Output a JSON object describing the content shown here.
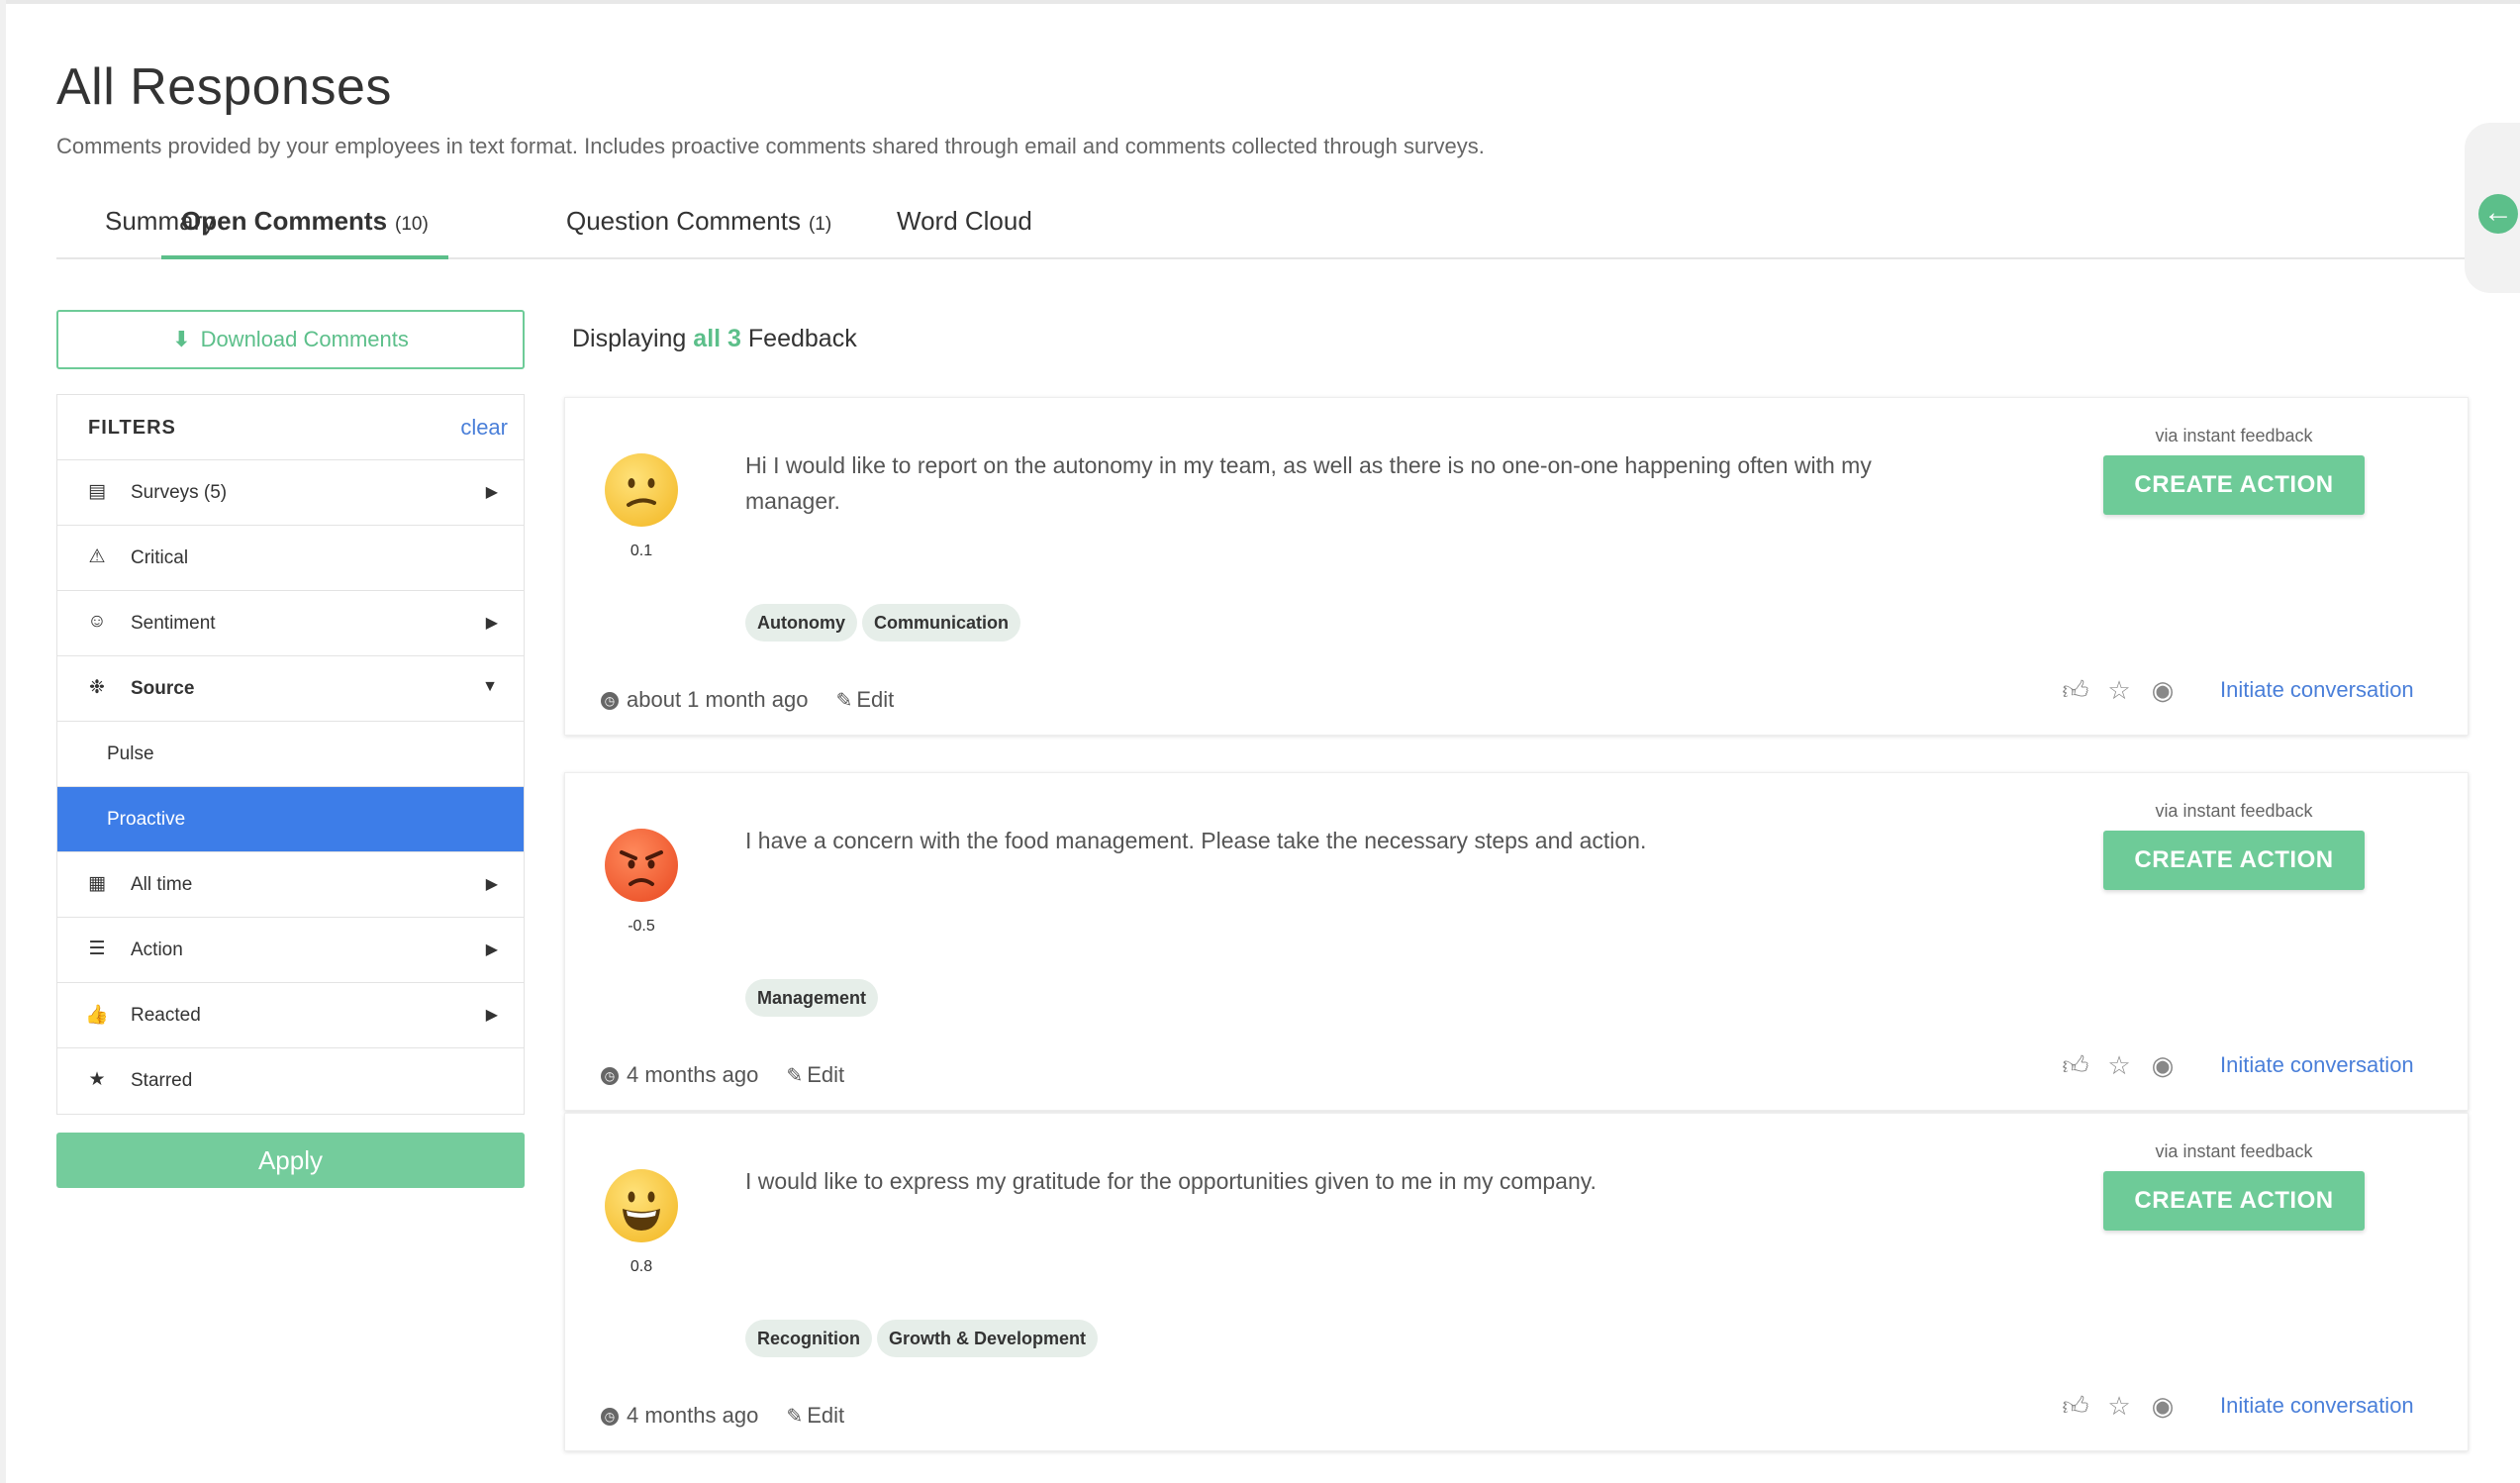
{
  "header": {
    "title": "All Responses",
    "subtitle": "Comments provided by your employees in text format. Includes proactive comments shared through email and comments collected through surveys."
  },
  "tabs": [
    {
      "label": "Summary",
      "count": ""
    },
    {
      "label": "Open Comments",
      "count": "(10)"
    },
    {
      "label": "Question Comments",
      "count": "(1)"
    },
    {
      "label": "Word Cloud",
      "count": ""
    }
  ],
  "sidebar": {
    "download_label": "Download Comments",
    "filters_title": "FILTERS",
    "clear_label": "clear",
    "rows": [
      {
        "label": "Surveys (5)",
        "icon": "survey-icon"
      },
      {
        "label": "Critical",
        "icon": "warning-icon"
      },
      {
        "label": "Sentiment",
        "icon": "smile-icon"
      },
      {
        "label": "Source",
        "icon": "gear-icon"
      },
      {
        "label": "Pulse"
      },
      {
        "label": "Proactive"
      },
      {
        "label": "All time",
        "icon": "calendar-icon"
      },
      {
        "label": "Action",
        "icon": "list-icon"
      },
      {
        "label": "Reacted",
        "icon": "thumbs-up-icon"
      },
      {
        "label": "Starred",
        "icon": "star-icon"
      }
    ],
    "apply_label": "Apply"
  },
  "main": {
    "displaying_prefix": "Displaying",
    "displaying_count": "all 3",
    "displaying_suffix": "Feedback",
    "cards": [
      {
        "score": "0.1",
        "sentiment": "neutral",
        "text": "Hi I would like to report on the autonomy in my team, as well as there is no one-on-one happening often with my manager.",
        "tags": [
          "Autonomy",
          "Communication"
        ],
        "time": "about 1 month ago",
        "edit_label": "Edit",
        "via": "via instant feedback",
        "create_label": "CREATE ACTION",
        "initiate_label": "Initiate conversation"
      },
      {
        "score": "-0.5",
        "sentiment": "angry",
        "text": "I have a concern with the food management. Please take the necessary steps and action.",
        "tags": [
          "Management"
        ],
        "time": "4 months ago",
        "edit_label": "Edit",
        "via": "via instant feedback",
        "create_label": "CREATE ACTION",
        "initiate_label": "Initiate conversation"
      },
      {
        "score": "0.8",
        "sentiment": "happy",
        "text": "I would like to express my gratitude for the opportunities given to me in my company.",
        "tags": [
          "Recognition",
          "Growth & Development"
        ],
        "time": "4 months ago",
        "edit_label": "Edit",
        "via": "via instant feedback",
        "create_label": "CREATE ACTION",
        "initiate_label": "Initiate conversation"
      }
    ]
  },
  "colors": {
    "accent_green": "#6ecb98",
    "link_blue": "#4a7fd9",
    "selected_blue": "#3d7de8"
  }
}
